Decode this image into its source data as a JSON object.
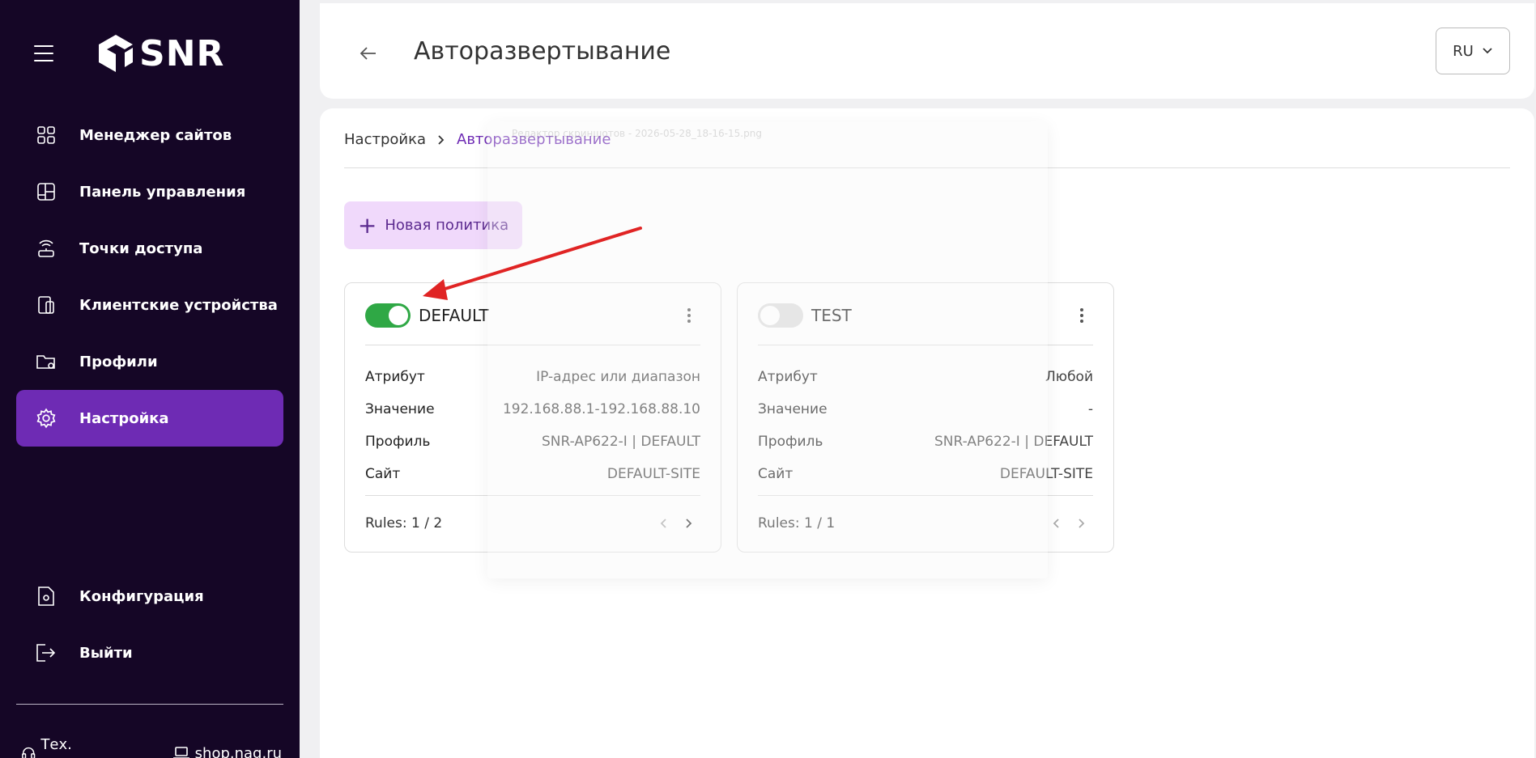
{
  "app": {
    "logo_text": "SNR"
  },
  "sidebar": {
    "items": [
      {
        "label": "Менеджер сайтов",
        "icon": "grid-icon"
      },
      {
        "label": "Панель управления",
        "icon": "dashboard-icon"
      },
      {
        "label": "Точки доступа",
        "icon": "access-point-icon"
      },
      {
        "label": "Клиентские устройства",
        "icon": "devices-icon"
      },
      {
        "label": "Профили",
        "icon": "folder-gear-icon"
      },
      {
        "label": "Настройка",
        "icon": "gear-icon",
        "active": true
      }
    ],
    "bottom_items": [
      {
        "label": "Конфигурация",
        "icon": "file-gear-icon"
      },
      {
        "label": "Выйти",
        "icon": "logout-icon"
      }
    ],
    "footer": {
      "support": "Тех. поддержка",
      "shop": "shop.nag.ru"
    }
  },
  "header": {
    "title": "Авторазвертывание",
    "lang": "RU"
  },
  "breadcrumb": {
    "parent": "Настройка",
    "current": "Авторазвертывание"
  },
  "toolbar": {
    "new_policy_label": "Новая политика"
  },
  "overlay": {
    "title": "Редактор скриншотов - 2026-05-28_18-16-15.png"
  },
  "policies": [
    {
      "name": "DEFAULT",
      "enabled": true,
      "attribute_label": "Атрибут",
      "attribute_value": "IP-адрес или диапазон",
      "value_label": "Значение",
      "value_value": "192.168.88.1-192.168.88.10",
      "profile_label": "Профиль",
      "profile_value": "SNR-AP622-I | DEFAULT",
      "site_label": "Сайт",
      "site_value": "DEFAULT-SITE",
      "rules": "Rules: 1 / 2"
    },
    {
      "name": "TEST",
      "enabled": false,
      "attribute_label": "Атрибут",
      "attribute_value": "Любой",
      "value_label": "Значение",
      "value_value": "-",
      "profile_label": "Профиль",
      "profile_value": "SNR-AP622-I | DEFAULT",
      "site_label": "Сайт",
      "site_value": "DEFAULT-SITE",
      "rules": "Rules: 1 / 1"
    }
  ],
  "colors": {
    "sidebar_bg": "#150626",
    "accent": "#6e2bb4",
    "toggle_on": "#2fa845",
    "annotation_arrow": "#e02424"
  }
}
